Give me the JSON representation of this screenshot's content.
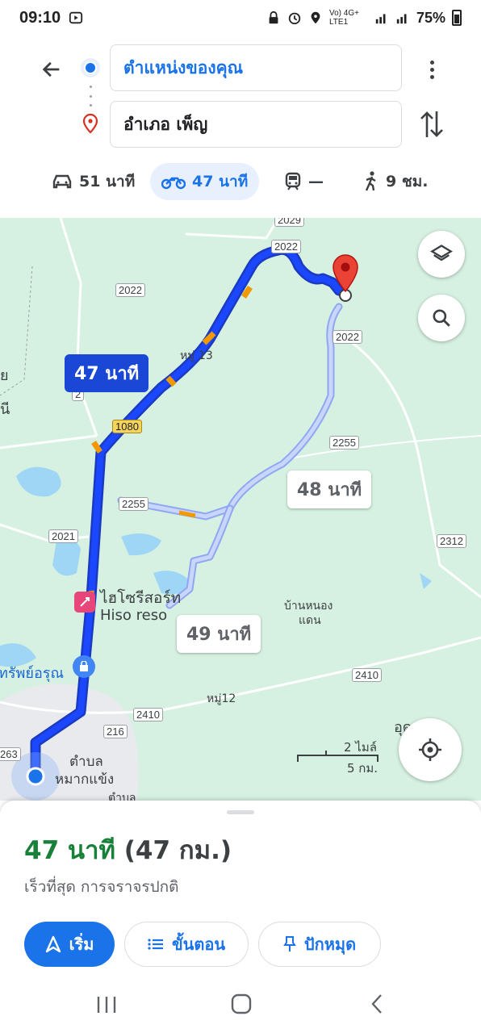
{
  "status_bar": {
    "time": "09:10",
    "network": "Vo) 4G+ LTE1",
    "battery": "75%"
  },
  "header": {
    "origin": "ตำแหน่งของคุณ",
    "destination": "อำเภอ เพ็ญ",
    "modes": [
      {
        "name": "car",
        "label": "51 นาที"
      },
      {
        "name": "motorbike",
        "label": "47 นาที"
      },
      {
        "name": "transit",
        "label": "—"
      },
      {
        "name": "walk",
        "label": "9 ชม."
      }
    ]
  },
  "map": {
    "route_time_main": "47 นาที",
    "route_time_alt1": "48 นาที",
    "route_time_alt2": "49 นาที",
    "road_labels": [
      "2022",
      "2022",
      "2022",
      "2",
      "1080",
      "2255",
      "2255",
      "2021",
      "2312",
      "2410",
      "2410",
      "216",
      "263",
      "2029"
    ],
    "place_labels": [
      "หมู่ 13",
      "บ้านหนอง",
      "แดน",
      "หมู่12",
      "ตำบล",
      "หมากแข้ง",
      "ตำบล",
      "อุด",
      "ย",
      "นี"
    ],
    "poi_hotel": "ไฮโซรีสอร์ท",
    "poi_hotel_en": "Hiso reso",
    "poi_shop": "ทรัพย์อรุณ",
    "scale_top": "2 ไมล์",
    "scale_bottom": "5 กม."
  },
  "sheet": {
    "duration": "47 นาที",
    "distance": "(47 กม.)",
    "subtitle": "เร็วที่สุด การจราจรปกติ",
    "buttons": {
      "start": "เริ่ม",
      "steps": "ขั้นตอน",
      "pin": "ปักหมุด"
    }
  },
  "colors": {
    "route": "#1a47d6",
    "accent": "#1a73e8",
    "duration": "#188038",
    "map_bg": "#d6f1e1"
  }
}
